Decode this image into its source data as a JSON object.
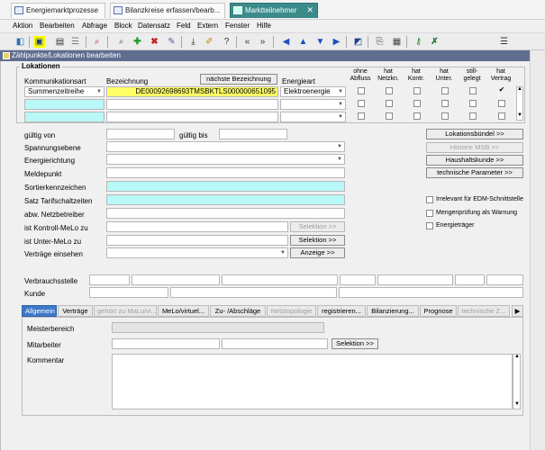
{
  "tabs": [
    {
      "label": "Energiemarktprozesse"
    },
    {
      "label": "Bilanzkreise erfassen/bearb..."
    },
    {
      "label": "Marktteilnehmer",
      "close": "✕"
    }
  ],
  "menu": [
    "Aktion",
    "Bearbeiten",
    "Abfrage",
    "Block",
    "Datensatz",
    "Feld",
    "Extern",
    "Fenster",
    "Hilfe"
  ],
  "window_title": "Zählpunkte/Lokationen bearbeiten",
  "locations": {
    "group_label": "Lokationen",
    "col_kommunikationsart": "Kommunikationsart",
    "col_bezeichnung": "Bezeichnung",
    "next_button": "nächste Bezeichnung",
    "col_energieart": "Energieart",
    "flag_headers": [
      {
        "l1": "ohne",
        "l2": "Abfluss"
      },
      {
        "l1": "hat",
        "l2": "Netzkn."
      },
      {
        "l1": "hat",
        "l2": "Kontr."
      },
      {
        "l1": "hat",
        "l2": "Unter."
      },
      {
        "l1": "still-",
        "l2": "gelegt"
      },
      {
        "l1": "hat",
        "l2": "Vertrag"
      }
    ],
    "row1": {
      "kommunikationsart": "Summenzeitreihe",
      "bezeichnung": "DE00092698693TMSBKTLS000000651095",
      "energieart": "Elektroenergie",
      "checked_mark": "✔"
    }
  },
  "form": {
    "gueltig_von": "gültig von",
    "gueltig_bis": "gültig bis",
    "spannungsebene": "Spannungsebene",
    "energierichtung": "Energierichtung",
    "meldepunkt": "Meldepunkt",
    "sortierkennzeichen": "Sortierkennzeichen",
    "satz_tarifschaltzeiten": "Satz Tarifschaltzeiten",
    "abw_netzbetreiber": "abw. Netzbetreiber",
    "ist_kontroll_melo": "ist Kontroll-MeLo zu",
    "ist_unter_melo": "ist Unter-MeLo zu",
    "vertraege_einsehen": "Verträge einsehen",
    "selektion_label": "Selektion  >>",
    "anzeige_label": "Anzeige  >>"
  },
  "side_buttons": {
    "lokationsbuendel": "Lokationsbündel         >>",
    "historie_msb": "Historie MSB      >>",
    "haushaltskunde": "Haushaltskunde        >>",
    "technische_parameter": "technische Parameter >>"
  },
  "side_checks": {
    "irrelevant_edm": "Irrelevant für EDM-Schnittstelle",
    "mengenpruefung": "Mengenprüfung als Warnung",
    "energietraeger": "Energieträger"
  },
  "bottom_fields": {
    "verbrauchsstelle": "Verbrauchsstelle",
    "kunde": "Kunde"
  },
  "bottom_tabs": [
    {
      "label": "Allgemein"
    },
    {
      "label": "Verträge"
    },
    {
      "label": "gehört zu MaLo/vi..."
    },
    {
      "label": "MeLo/virtuel..."
    },
    {
      "label": "Zu- /Abschläge"
    },
    {
      "label": "Netztopologie"
    },
    {
      "label": "registrieren..."
    },
    {
      "label": "Bilanzierung..."
    },
    {
      "label": "Prognose"
    },
    {
      "label": "technische Z..."
    }
  ],
  "tab_content": {
    "meisterbereich": "Meisterbereich",
    "mitarbeiter": "Mitarbeiter",
    "kommentar": "Kommentar",
    "selektion_label": "Selektion  >>"
  },
  "colors": {
    "active_tab": "#3c8b8b",
    "title_bar": "#5f6d8f",
    "cyan_field": "#b8f8f8",
    "highlight": "#ffff00",
    "bottom_tab_active": "#3e79c8"
  }
}
